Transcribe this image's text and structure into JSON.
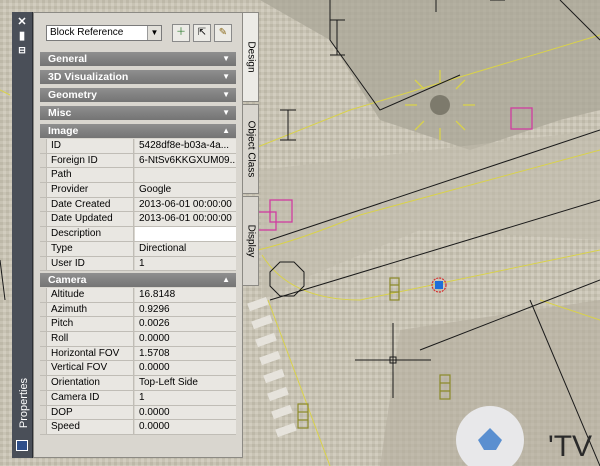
{
  "palette": {
    "title": "Properties",
    "object_type": "Block Reference",
    "toolbar": [
      "toggle-pickadd",
      "select-objects",
      "quick-select"
    ],
    "vertical_tabs": [
      "Design",
      "Object Class",
      "Display"
    ]
  },
  "sections": {
    "general": "General",
    "viz3d": "3D Visualization",
    "geometry": "Geometry",
    "misc": "Misc",
    "image": "Image",
    "camera": "Camera"
  },
  "image_rows": [
    {
      "k": "ID",
      "v": "5428df8e-b03a-4a..."
    },
    {
      "k": "Foreign ID",
      "v": "6-NtSv6KKGXUM09..."
    },
    {
      "k": "Path",
      "v": ""
    },
    {
      "k": "Provider",
      "v": "Google"
    },
    {
      "k": "Date Created",
      "v": "2013-06-01 00:00:00"
    },
    {
      "k": "Date Updated",
      "v": "2013-06-01 00:00:00"
    },
    {
      "k": "Description",
      "v": ""
    },
    {
      "k": "Type",
      "v": "Directional"
    },
    {
      "k": "User ID",
      "v": "1"
    }
  ],
  "camera_rows": [
    {
      "k": "Altitude",
      "v": "16.8148"
    },
    {
      "k": "Azimuth",
      "v": "0.9296"
    },
    {
      "k": "Pitch",
      "v": "0.0026"
    },
    {
      "k": "Roll",
      "v": "0.0000"
    },
    {
      "k": "Horizontal FOV",
      "v": "1.5708"
    },
    {
      "k": "Vertical FOV",
      "v": "0.0000"
    },
    {
      "k": "Orientation",
      "v": "Top-Left Side"
    },
    {
      "k": "Camera ID",
      "v": "1"
    },
    {
      "k": "DOP",
      "v": "0.0000"
    },
    {
      "k": "Speed",
      "v": "0.0000"
    }
  ],
  "map_label": "'TV",
  "colors": {
    "cad_yellow": "#d9d24a",
    "cad_magenta": "#d03ca0",
    "cad_olive": "#8c8a2a",
    "marker_blue": "#1e6ed8"
  }
}
